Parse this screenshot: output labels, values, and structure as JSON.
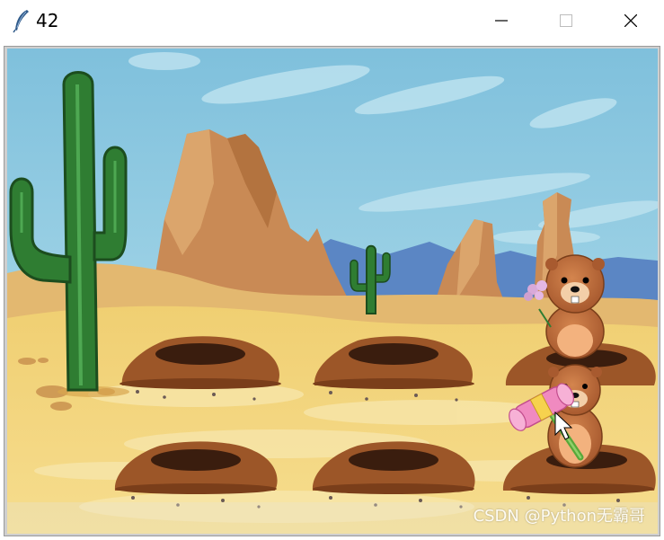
{
  "window": {
    "title": "42",
    "icon": "feather-icon",
    "controls": [
      "minimize-icon",
      "maximize-icon",
      "close-icon"
    ]
  },
  "game": {
    "scene": "desert",
    "holes": 6,
    "moles_visible": 2,
    "cursor": "hammer-icon"
  },
  "watermark": "CSDN @Python无霸哥",
  "colors": {
    "sky": "#86c6df",
    "sand": "#f3d77e",
    "cactus": "#2f7d32",
    "mole": "#b8663a",
    "hole": "#8a4a22"
  }
}
